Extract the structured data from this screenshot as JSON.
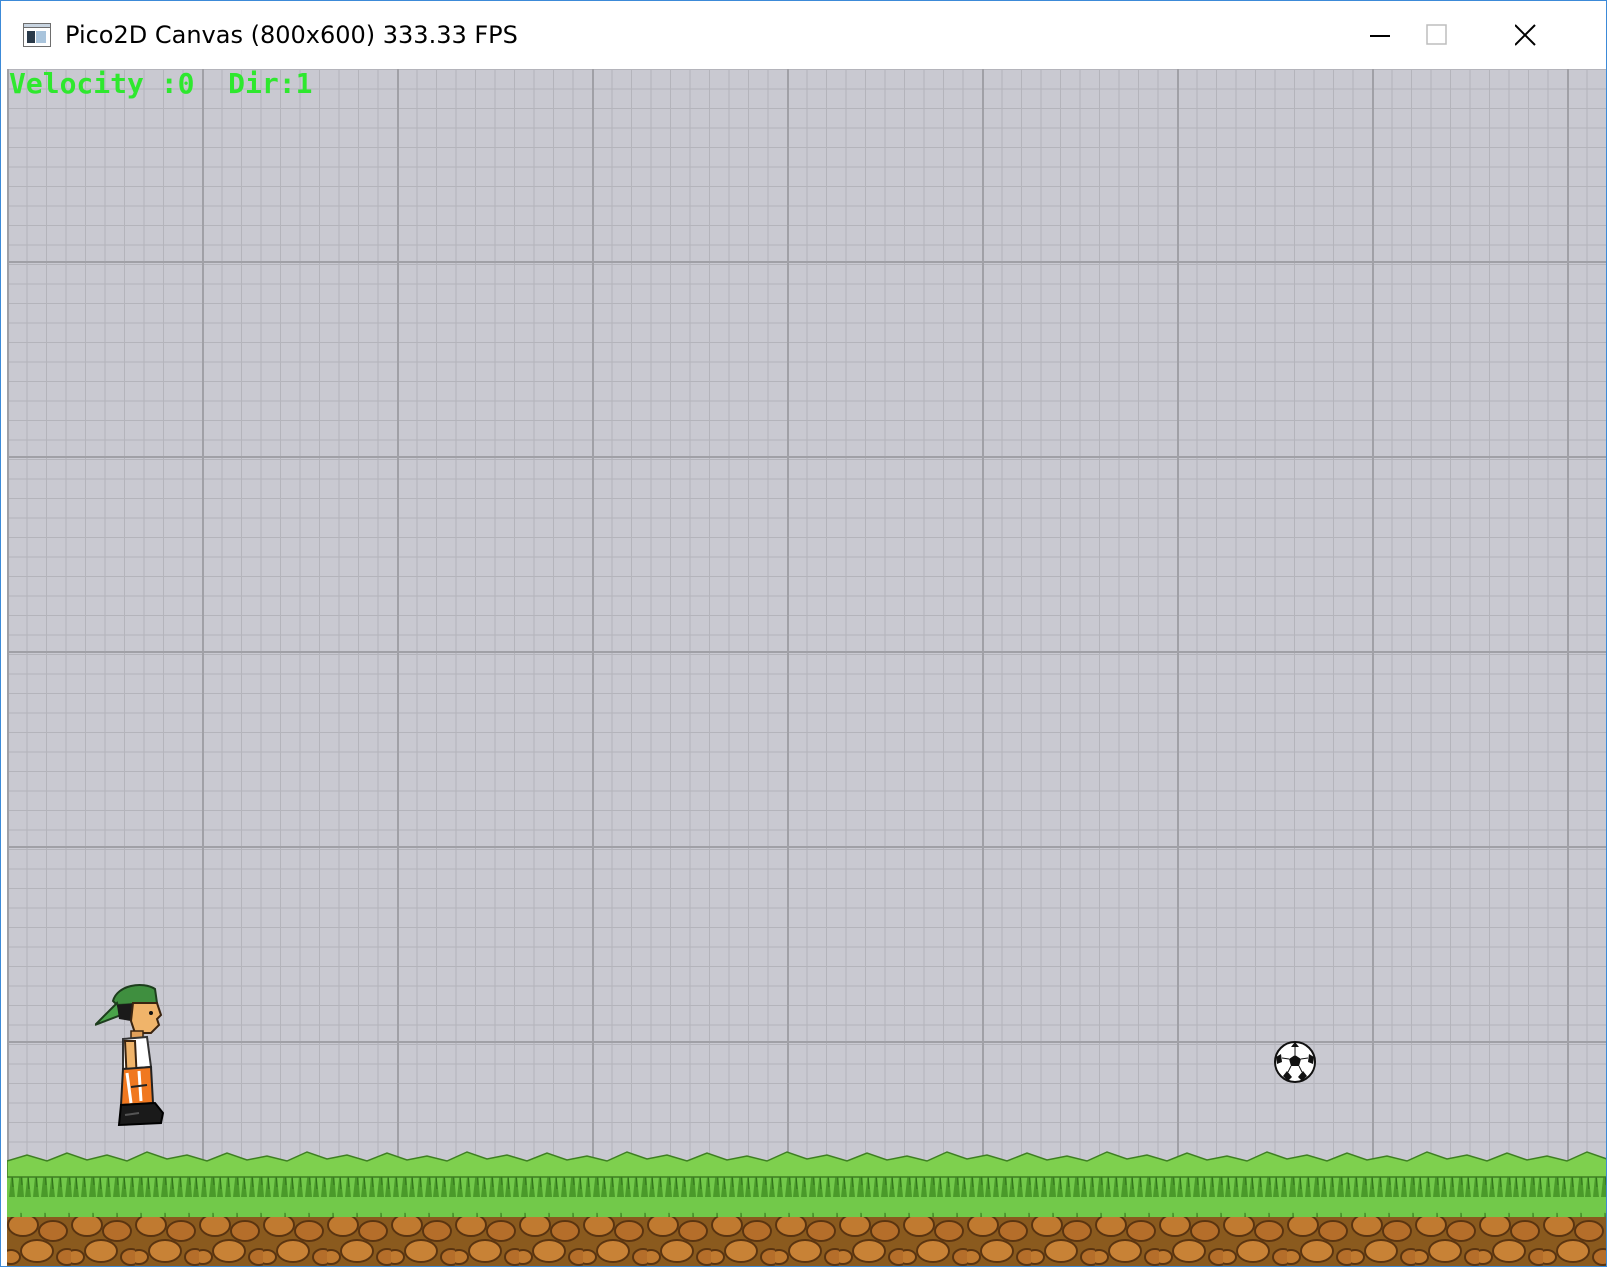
{
  "window": {
    "title": "Pico2D Canvas (800x600) 333.33 FPS",
    "border_color": "#3c8ad8"
  },
  "titlebar_buttons": {
    "minimize": "minimize-icon",
    "maximize": "maximize-icon",
    "close": "close-icon"
  },
  "hud": {
    "text": "Velocity :0  Dir:1",
    "color": "#2ee82e"
  },
  "scene": {
    "background_color": "#c9c9d1",
    "grid": true,
    "objects": [
      "player-character",
      "soccer-ball",
      "grass-ground"
    ]
  }
}
